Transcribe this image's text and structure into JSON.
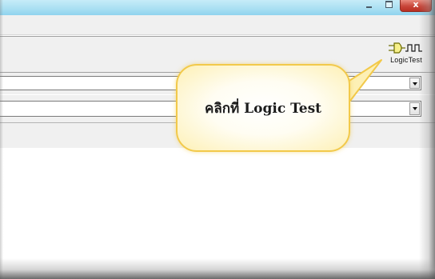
{
  "window": {
    "minimize_icon": "minimize-icon",
    "maximize_icon": "maximize-icon",
    "close_symbol": "x",
    "titlebar_color": "#a8dff2",
    "close_color": "#c9463a"
  },
  "toolbar": {
    "logic_test_label": "LogicTest",
    "logic_test_icon": "logic-probe-icon"
  },
  "combos": [
    {
      "value": "",
      "arrow_icon": "chevron-down-icon"
    },
    {
      "value": "",
      "arrow_icon": "chevron-down-icon"
    }
  ],
  "callout": {
    "text": "คลิกที่ Logic Test",
    "border_color": "#f2c94a",
    "fill_color": "#fdf0b5"
  }
}
